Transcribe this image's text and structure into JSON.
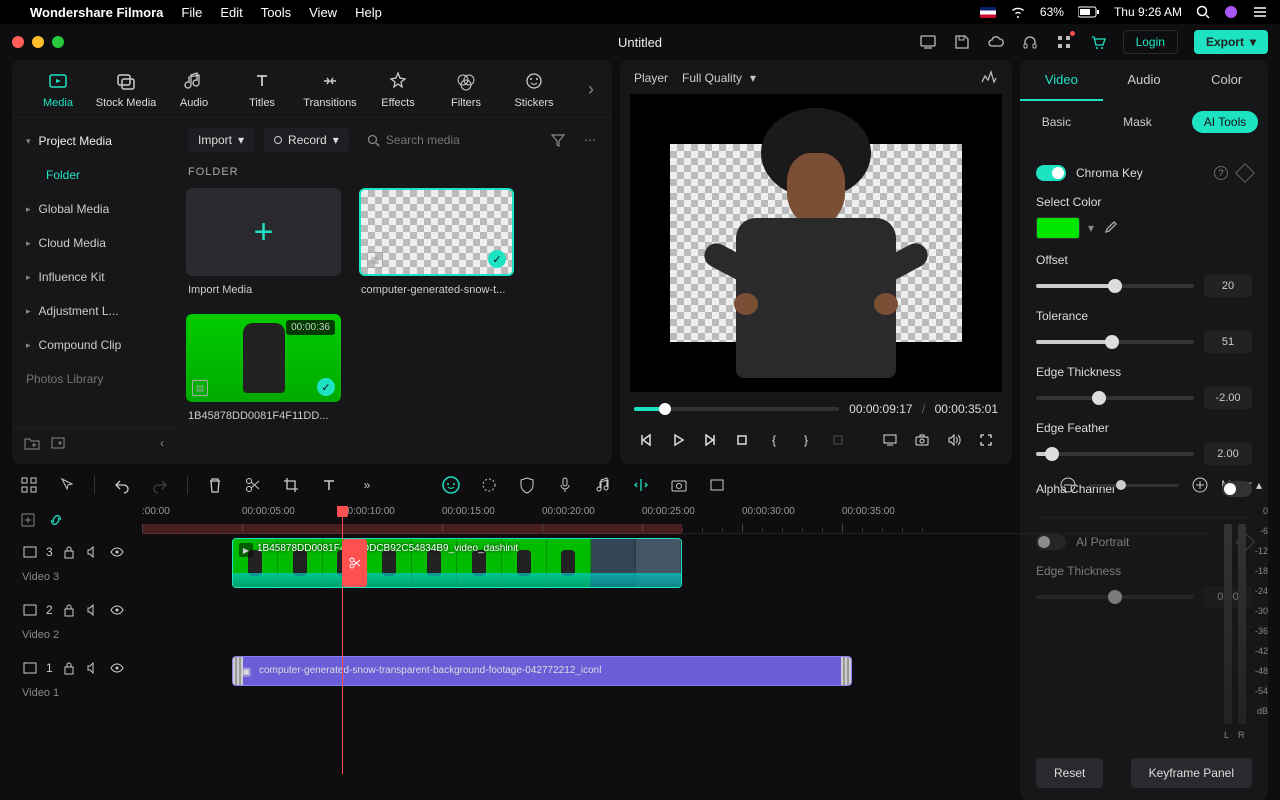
{
  "menubar": {
    "app": "Wondershare Filmora",
    "items": [
      "File",
      "Edit",
      "Tools",
      "View",
      "Help"
    ],
    "battery": "63%",
    "time": "Thu 9:26 AM"
  },
  "window": {
    "title": "Untitled",
    "login": "Login",
    "export": "Export"
  },
  "tabs": {
    "items": [
      "Media",
      "Stock Media",
      "Audio",
      "Titles",
      "Transitions",
      "Effects",
      "Filters",
      "Stickers"
    ],
    "active": 0
  },
  "media_nav": {
    "header": "Project Media",
    "active": "Folder",
    "items": [
      "Global Media",
      "Cloud Media",
      "Influence Kit",
      "Adjustment L...",
      "Compound Clip",
      "Photos Library"
    ]
  },
  "media_toolbar": {
    "import": "Import",
    "record": "Record",
    "search_placeholder": "Search media"
  },
  "folder_label": "FOLDER",
  "media_tiles": [
    {
      "caption": "Import Media",
      "kind": "import"
    },
    {
      "caption": "computer-generated-snow-t...",
      "kind": "checker",
      "checked": true
    },
    {
      "caption": "1B45878DD0081F4F11DD...",
      "kind": "green",
      "duration": "00:00:36",
      "checked": true
    }
  ],
  "player": {
    "label": "Player",
    "quality": "Full Quality",
    "current": "00:00:09:17",
    "total": "00:00:35:01"
  },
  "props": {
    "tabs": [
      "Video",
      "Audio",
      "Color"
    ],
    "active_tab": 0,
    "subtabs": [
      "Basic",
      "Mask",
      "AI Tools"
    ],
    "active_subtab": 2,
    "chroma": {
      "title": "Chroma Key",
      "select_color": "Select Color",
      "color": "#00e600",
      "offset": {
        "label": "Offset",
        "value": "20",
        "pct": 50
      },
      "tolerance": {
        "label": "Tolerance",
        "value": "51",
        "pct": 48
      },
      "edge_thickness": {
        "label": "Edge Thickness",
        "value": "-2.00",
        "pct": 40
      },
      "edge_feather": {
        "label": "Edge Feather",
        "value": "2.00",
        "pct": 10
      },
      "alpha": "Alpha Channel"
    },
    "ai_portrait": {
      "title": "AI Portrait",
      "edge_thickness": {
        "label": "Edge Thickness",
        "value": "0.00",
        "pct": 50
      }
    },
    "reset": "Reset",
    "keyframe": "Keyframe Panel"
  },
  "timeline": {
    "meter_label": "Meter",
    "ticks": [
      ":00:00",
      "00:00:05:00",
      "00:00:10:00",
      "00:00:15:00",
      "00:00:20:00",
      "00:00:25:00",
      "00:00:30:00",
      "00:00:35:00"
    ],
    "db_ticks": [
      "0",
      "-6",
      "-12",
      "-18",
      "-24",
      "-30",
      "-36",
      "-42",
      "-48",
      "-54",
      "dB"
    ],
    "tracks": [
      {
        "id": "3",
        "name": "Video 3"
      },
      {
        "id": "2",
        "name": "Video 2"
      },
      {
        "id": "1",
        "name": "Video 1"
      }
    ],
    "clip_video_label": "1B45878DD0081F4F11DDCB92C54834B9_video_dashinit",
    "clip_image_label": "computer-generated-snow-transparent-background-footage-042772212_iconl"
  }
}
